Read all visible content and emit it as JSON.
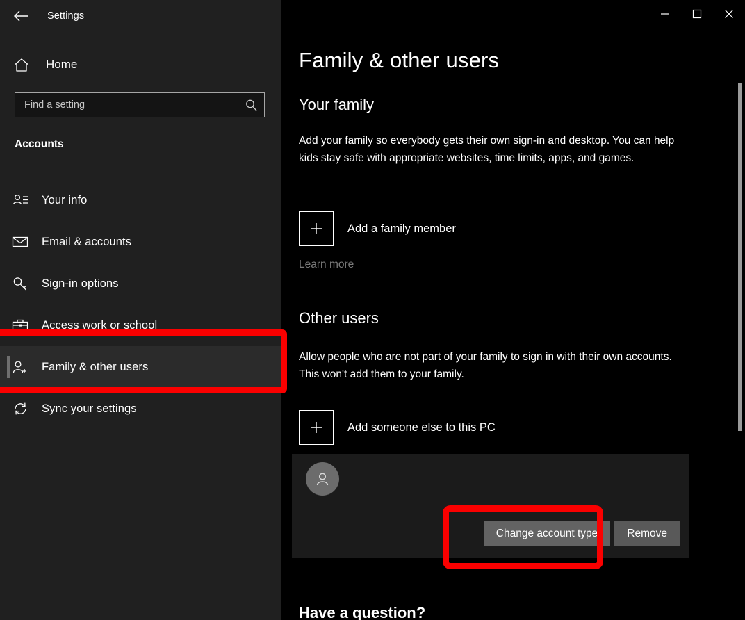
{
  "window": {
    "app_title": "Settings",
    "back_icon": "back-arrow-icon",
    "controls": {
      "minimize": "minimize-icon",
      "maximize": "maximize-icon",
      "close": "close-icon"
    }
  },
  "sidebar": {
    "home_label": "Home",
    "home_icon": "home-icon",
    "search": {
      "placeholder": "Find a setting",
      "value": "",
      "icon": "search-icon"
    },
    "section_title": "Accounts",
    "items": [
      {
        "label": "Your info",
        "icon": "user-info-icon",
        "selected": false
      },
      {
        "label": "Email & accounts",
        "icon": "envelope-icon",
        "selected": false
      },
      {
        "label": "Sign-in options",
        "icon": "key-icon",
        "selected": false
      },
      {
        "label": "Access work or school",
        "icon": "briefcase-icon",
        "selected": false
      },
      {
        "label": "Family & other users",
        "icon": "user-add-icon",
        "selected": true
      },
      {
        "label": "Sync your settings",
        "icon": "sync-icon",
        "selected": false
      }
    ]
  },
  "main": {
    "page_title": "Family & other users",
    "family": {
      "heading": "Your family",
      "description": "Add your family so everybody gets their own sign-in and desktop. You can help kids stay safe with appropriate websites, time limits, apps, and games.",
      "add_label": "Add a family member",
      "add_icon": "plus-icon",
      "learn_more": "Learn more"
    },
    "other_users": {
      "heading": "Other users",
      "description": "Allow people who are not part of your family to sign in with their own accounts. This won't add them to your family.",
      "add_label": "Add someone else to this PC",
      "add_icon": "plus-icon",
      "account": {
        "avatar_icon": "person-avatar-icon",
        "change_type_label": "Change account type",
        "remove_label": "Remove"
      }
    },
    "footer_heading": "Have a question?"
  },
  "annotations": {
    "color": "#fa0000",
    "highlighted": [
      "sidebar-item-family-other-users",
      "change-account-type-button"
    ]
  },
  "scrollbar": {
    "icon": "vertical-scrollbar"
  }
}
